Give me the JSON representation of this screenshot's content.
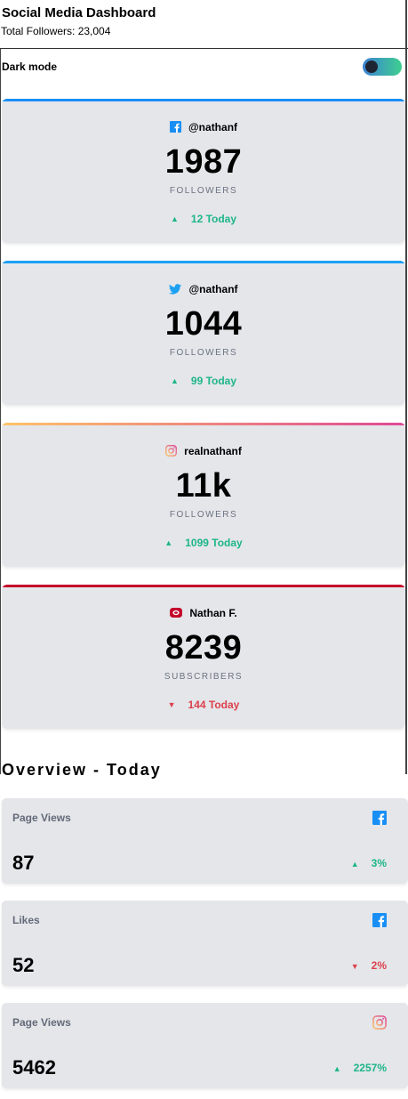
{
  "header": {
    "title": "Social Media Dashboard",
    "total_followers": "Total Followers: 23,004"
  },
  "dark_mode": {
    "label": "Dark mode",
    "enabled": true
  },
  "cards": [
    {
      "platform": "facebook",
      "icon": "facebook-icon",
      "accent": "#198ff5",
      "handle": "@nathanf",
      "count": "1987",
      "unit": "FOLLOWERS",
      "trend": "up",
      "delta": "12 Today"
    },
    {
      "platform": "twitter",
      "icon": "twitter-icon",
      "accent": "#1ca0f2",
      "handle": "@nathanf",
      "count": "1044",
      "unit": "FOLLOWERS",
      "trend": "up",
      "delta": "99 Today"
    },
    {
      "platform": "instagram",
      "icon": "instagram-icon",
      "accent": "#df4996",
      "handle": "realnathanf",
      "count": "11k",
      "unit": "FOLLOWERS",
      "trend": "up",
      "delta": "1099 Today"
    },
    {
      "platform": "youtube",
      "icon": "youtube-icon",
      "accent": "#c4032a",
      "handle": "Nathan F.",
      "count": "8239",
      "unit": "SUBSCRIBERS",
      "trend": "down",
      "delta": "144 Today"
    }
  ],
  "overview": {
    "title": "Overview - Today",
    "items": [
      {
        "name": "Page Views",
        "icon": "facebook-icon",
        "value": "87",
        "trend": "up",
        "percent": "3%"
      },
      {
        "name": "Likes",
        "icon": "facebook-icon",
        "value": "52",
        "trend": "down",
        "percent": "2%"
      },
      {
        "name": "Page Views",
        "icon": "instagram-icon",
        "value": "5462",
        "trend": "up",
        "percent": "2257%"
      }
    ]
  },
  "colors": {
    "up": "#1eb589",
    "down": "#dc414c",
    "card_bg": "#e4e6ea",
    "facebook": "#198ff5",
    "twitter": "#1ca0f2",
    "youtube": "#c4032a"
  }
}
